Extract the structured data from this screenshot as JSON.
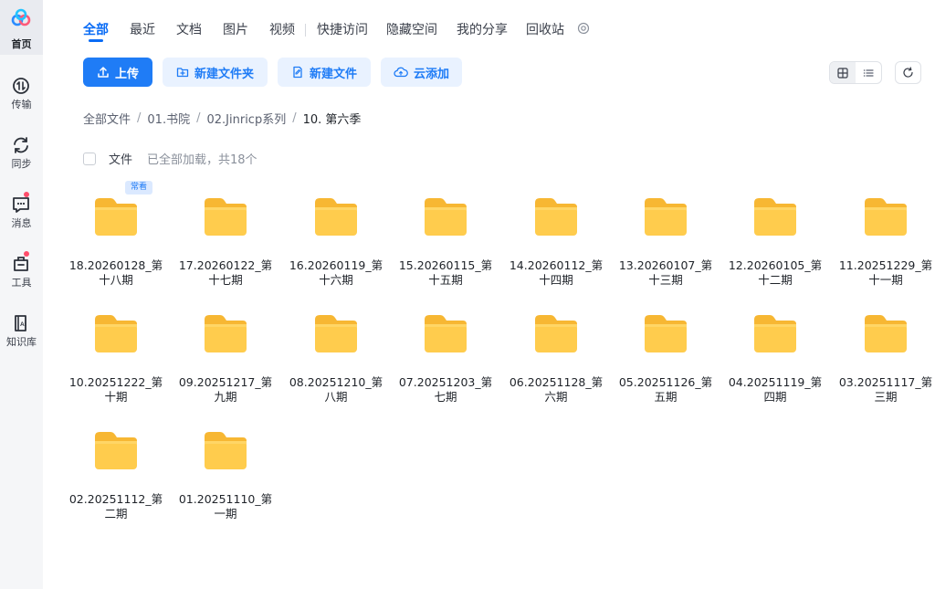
{
  "sidebar": {
    "items": [
      {
        "label": "首页",
        "icon": "baidu-cloud-logo-icon"
      },
      {
        "label": "传输",
        "icon": "transfer-icon"
      },
      {
        "label": "同步",
        "icon": "sync-icon"
      },
      {
        "label": "消息",
        "icon": "message-icon"
      },
      {
        "label": "工具",
        "icon": "toolbox-icon"
      },
      {
        "label": "知识库",
        "icon": "ai-knowledge-icon"
      }
    ]
  },
  "tabs": [
    "全部",
    "最近",
    "文档",
    "图片",
    "视频",
    "快捷访问",
    "隐藏空间",
    "我的分享",
    "回收站"
  ],
  "toolbar": {
    "upload": "上传",
    "new_folder": "新建文件夹",
    "new_file": "新建文件",
    "cloud_add": "云添加"
  },
  "breadcrumb": [
    "全部文件",
    "01.书院",
    "02.Jinricp系列",
    "10. 第六季"
  ],
  "list_header": {
    "label": "文件",
    "count": "已全部加载，共18个"
  },
  "badge": "常看",
  "folders": [
    "18.20260128_第十八期",
    "17.20260122_第十七期",
    "16.20260119_第十六期",
    "15.20260115_第十五期",
    "14.20260112_第十四期",
    "13.20260107_第十三期",
    "12.20260105_第十二期",
    "11.20251229_第十一期",
    "10.20251222_第十期",
    "09.20251217_第九期",
    "08.20251210_第八期",
    "07.20251203_第七期",
    "06.20251128_第六期",
    "05.20251126_第五期",
    "04.20251119_第四期",
    "03.20251117_第三期",
    "02.20251112_第二期",
    "01.20251110_第一期"
  ],
  "colors": {
    "accent": "#1f7cf6",
    "folder": "#ffc947"
  }
}
